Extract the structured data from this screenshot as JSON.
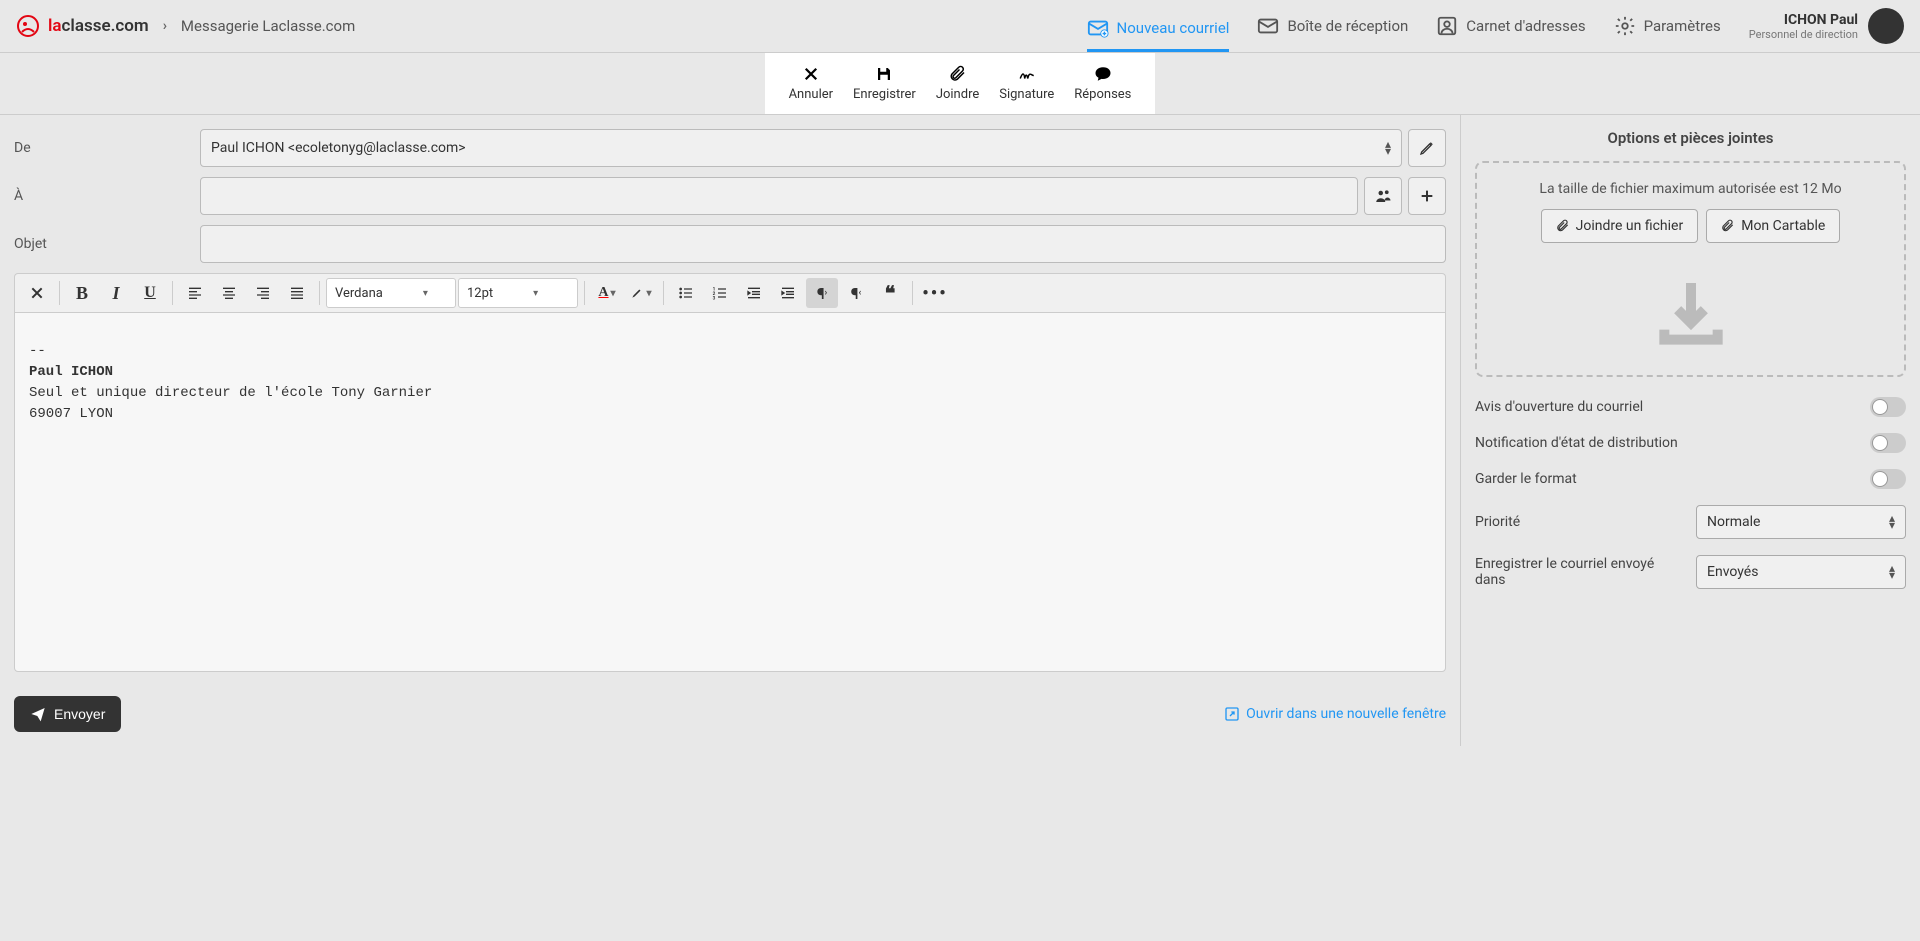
{
  "header": {
    "brand_la": "la",
    "brand_classe": "classe",
    "brand_com": ".com",
    "breadcrumb": "Messagerie Laclasse.com",
    "nav": {
      "new_mail": "Nouveau courriel",
      "inbox": "Boîte de réception",
      "contacts": "Carnet d'adresses",
      "settings": "Paramètres"
    },
    "user": {
      "name": "ICHON Paul",
      "role": "Personnel de direction"
    }
  },
  "toolbar": {
    "cancel": "Annuler",
    "save": "Enregistrer",
    "attach": "Joindre",
    "signature": "Signature",
    "responses": "Réponses"
  },
  "form": {
    "from_label": "De",
    "from_value": "Paul ICHON <ecoletonyg@laclasse.com>",
    "to_label": "À",
    "to_value": "",
    "subject_label": "Objet",
    "subject_value": ""
  },
  "editor": {
    "font_family": "Verdana",
    "font_size": "12pt",
    "body_sep": "--",
    "body_name": "Paul ICHON",
    "body_line1": "Seul et unique directeur de l'école Tony Garnier",
    "body_line2": "69007 LYON"
  },
  "actions": {
    "send": "Envoyer",
    "open_window": "Ouvrir dans une nouvelle fenêtre"
  },
  "right": {
    "title": "Options et pièces jointes",
    "max_size": "La taille de fichier maximum autorisée est 12 Mo",
    "attach_file": "Joindre un fichier",
    "my_bag": "Mon Cartable",
    "opt_read_receipt": "Avis d'ouverture du courriel",
    "opt_delivery": "Notification d'état de distribution",
    "opt_keep_format": "Garder le format",
    "opt_priority": "Priorité",
    "priority_value": "Normale",
    "opt_save_in": "Enregistrer le courriel envoyé dans",
    "save_in_value": "Envoyés"
  }
}
